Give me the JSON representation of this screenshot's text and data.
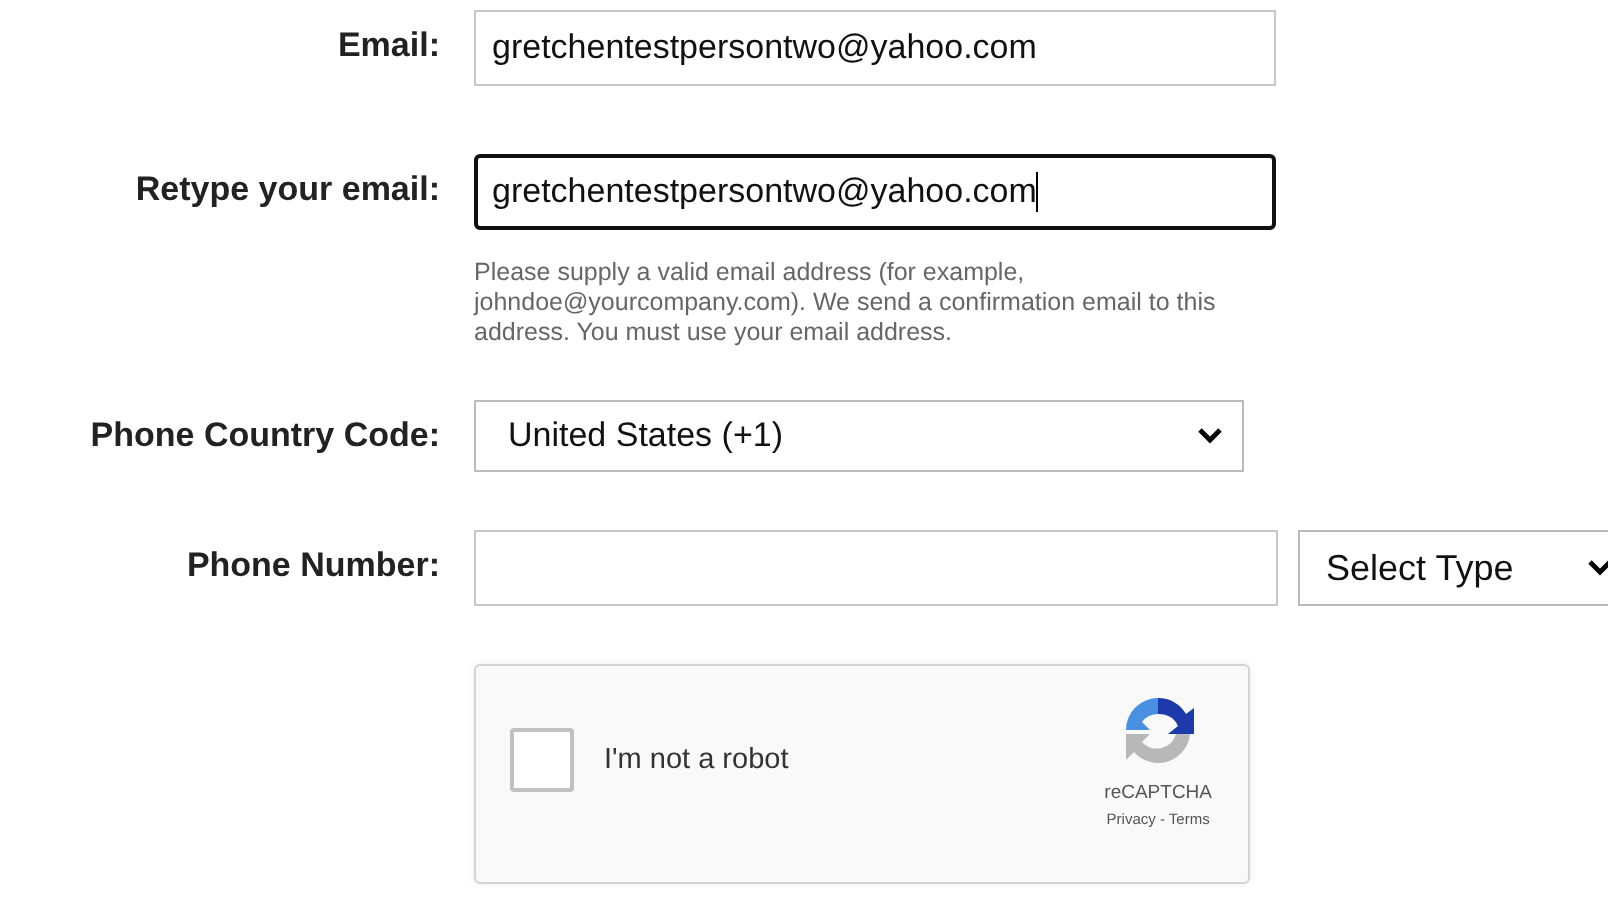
{
  "fields": [
    {
      "kind": "input",
      "label": "Email:",
      "value": "gretchentestpersontwo@yahoo.com",
      "focused": false
    },
    {
      "kind": "input",
      "label": "Retype your email:",
      "value": "gretchentestpersontwo@yahoo.com",
      "focused": true,
      "help": "Please supply a valid email address (for example, johndoe@yourcompany.com). We send a confirmation email to this address. You must use your email address."
    },
    {
      "kind": "select",
      "label": "Phone Country Code:",
      "value": "United States (+1)"
    },
    {
      "kind": "phone",
      "label": "Phone Number:",
      "type_select": "Select Type"
    }
  ],
  "captcha": {
    "label": "I'm not a robot",
    "checked": false,
    "brand": "reCAPTCHA",
    "links": "Privacy - Terms"
  }
}
